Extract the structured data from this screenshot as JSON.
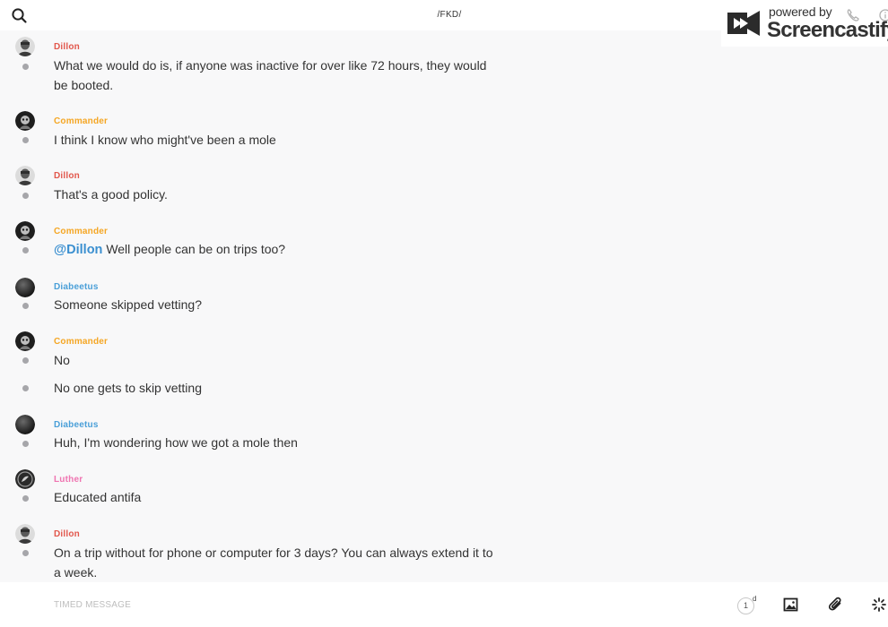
{
  "header": {
    "channel": "/FKD/",
    "search_icon": "search-icon"
  },
  "watermark": {
    "powered": "powered by",
    "brand": "Screencastify"
  },
  "author_colors": {
    "Dillon": "#e2574c",
    "Commander": "#f5a623",
    "Diabeetus": "#4a9fd8",
    "Luther": "#ef74b1"
  },
  "messages": [
    {
      "author": "Dillon",
      "avatar": "avatar-dillon",
      "text": "What we would do is, if anyone was inactive for over like 72 hours, they would be booted."
    },
    {
      "author": "Commander",
      "avatar": "avatar-commander",
      "text": "I think I know who might've been a mole"
    },
    {
      "author": "Dillon",
      "avatar": "avatar-dillon",
      "text": "That's a good policy."
    },
    {
      "author": "Commander",
      "avatar": "avatar-commander",
      "mention": "@Dillon",
      "text": "Well people can be on trips too?"
    },
    {
      "author": "Diabeetus",
      "avatar": "avatar-diabeetus",
      "text": "Someone skipped vetting?"
    },
    {
      "author": "Commander",
      "avatar": "avatar-commander",
      "text": "No"
    },
    {
      "author": "",
      "avatar": "",
      "text": "No one gets to skip vetting"
    },
    {
      "author": "Diabeetus",
      "avatar": "avatar-diabeetus",
      "text": "Huh, I'm wondering how we got a mole then"
    },
    {
      "author": "Luther",
      "avatar": "avatar-luther",
      "text": "Educated antifa"
    },
    {
      "author": "Dillon",
      "avatar": "avatar-dillon",
      "text": "On a trip without for phone or computer for 3 days? You can always extend it to a week."
    }
  ],
  "composer": {
    "placeholder": "TIMED MESSAGE",
    "timer_value": "1",
    "timer_unit": "d",
    "tools": [
      "image-icon",
      "paperclip-icon",
      "sparkle-icon"
    ]
  }
}
